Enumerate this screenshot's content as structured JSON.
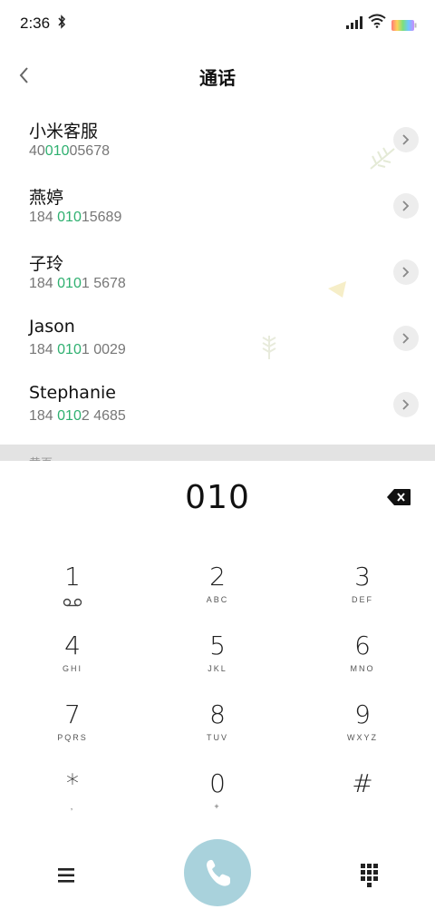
{
  "status_bar": {
    "time": "2:36",
    "icons": [
      "bluetooth-icon",
      "signal-icon",
      "wifi-icon",
      "battery-icon"
    ]
  },
  "header": {
    "title": "通话",
    "back_icon": "back-arrow-icon"
  },
  "contacts": [
    {
      "name": "小米客服",
      "number_pre": "40",
      "number_hl": "010",
      "number_post": "05678"
    },
    {
      "name": "燕婷",
      "number_pre": "184 ",
      "number_hl": "010",
      "number_post": "15689"
    },
    {
      "name": "子玲",
      "number_pre": "184 ",
      "number_hl": "010",
      "number_post": "1 5678"
    },
    {
      "name": "Jason",
      "number_pre": "184 ",
      "number_hl": "010",
      "number_post": "1 0029"
    },
    {
      "name": "Stephanie",
      "number_pre": "184 ",
      "number_hl": "010",
      "number_post": "2 4685"
    }
  ],
  "section_label": "黄页",
  "dialer": {
    "input_value": "010",
    "keys": [
      {
        "digit": "1",
        "letters": "ꝏ"
      },
      {
        "digit": "2",
        "letters": "ABC"
      },
      {
        "digit": "3",
        "letters": "DEF"
      },
      {
        "digit": "4",
        "letters": "GHI"
      },
      {
        "digit": "5",
        "letters": "JKL"
      },
      {
        "digit": "6",
        "letters": "MNO"
      },
      {
        "digit": "7",
        "letters": "PQRS"
      },
      {
        "digit": "8",
        "letters": "TUV"
      },
      {
        "digit": "9",
        "letters": "WXYZ"
      },
      {
        "digit": "*",
        "letters": ","
      },
      {
        "digit": "0",
        "letters": "+"
      },
      {
        "digit": "#",
        "letters": ""
      }
    ]
  },
  "colors": {
    "highlight": "#2fb070",
    "call_button": "#a9d2dc",
    "detail_button_bg": "#ededed"
  }
}
